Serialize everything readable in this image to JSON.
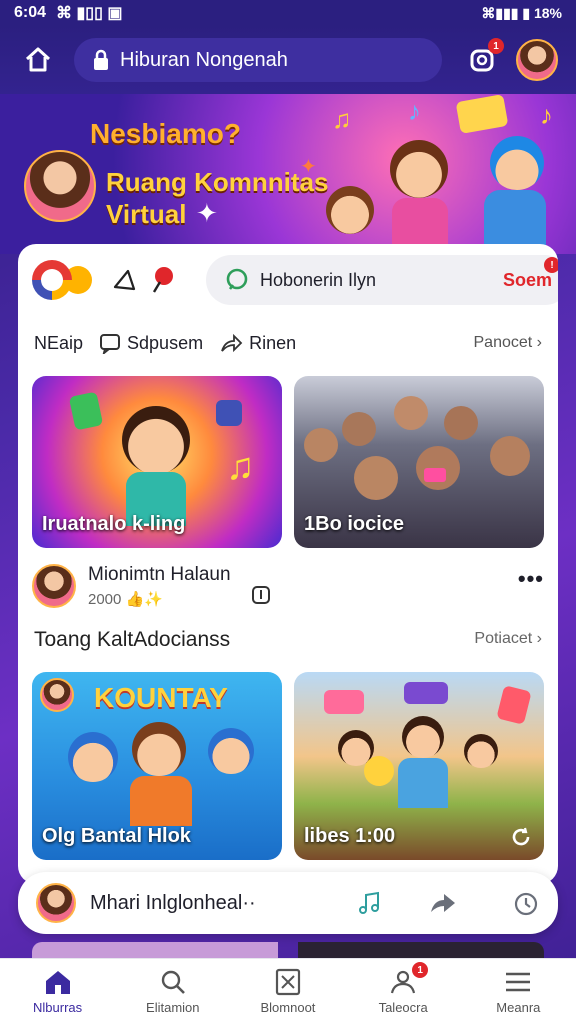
{
  "status_bar": {
    "time": "6:04",
    "icons_left": "⌘ ▮▯▯ ▣",
    "right_text": "⌘▮▮▮ ▮ 18%"
  },
  "top_bar": {
    "title": "Hiburan Nongenah",
    "notif_count": "1"
  },
  "banner": {
    "question": "Nesbiamo?",
    "line1": "Ruang Komnnitas",
    "line2": "Virtual"
  },
  "card": {
    "chat_label": "Hobonerin Ilyn",
    "open_label": "Soem",
    "actions": [
      {
        "label": "NEaip"
      },
      {
        "label": "Sdpusem"
      },
      {
        "label": "Rinen"
      }
    ],
    "more_label": "Panocet",
    "tiles": [
      {
        "caption": "Iruatnalo k-ling"
      },
      {
        "caption": "1Bo iocice"
      }
    ],
    "post": {
      "author": "Mionimtn Halaun",
      "meta": "2000 👍✨"
    },
    "section_title": "Toang KaltAdocianss",
    "section_more": "Potiacet",
    "tiles2": [
      {
        "caption": "Olg Bantal Hlok",
        "art_text": "KOUNTAY"
      },
      {
        "caption": "libes    1:00"
      }
    ]
  },
  "mini_player": {
    "title": "Mhari Inlglonheal··"
  },
  "bottom_nav": [
    {
      "label": "Nlburras",
      "icon": "home-icon",
      "active": true
    },
    {
      "label": "Elitamion",
      "icon": "search-icon",
      "active": false
    },
    {
      "label": "Blomnoot",
      "icon": "box-icon",
      "active": false
    },
    {
      "label": "Taleocra",
      "icon": "people-icon",
      "active": false,
      "badge": "1"
    },
    {
      "label": "Meanra",
      "icon": "menu-icon",
      "active": false
    }
  ],
  "colors": {
    "accent": "#3b2aa0",
    "badge": "#e0262b",
    "banner_text": "#ffd23d"
  }
}
